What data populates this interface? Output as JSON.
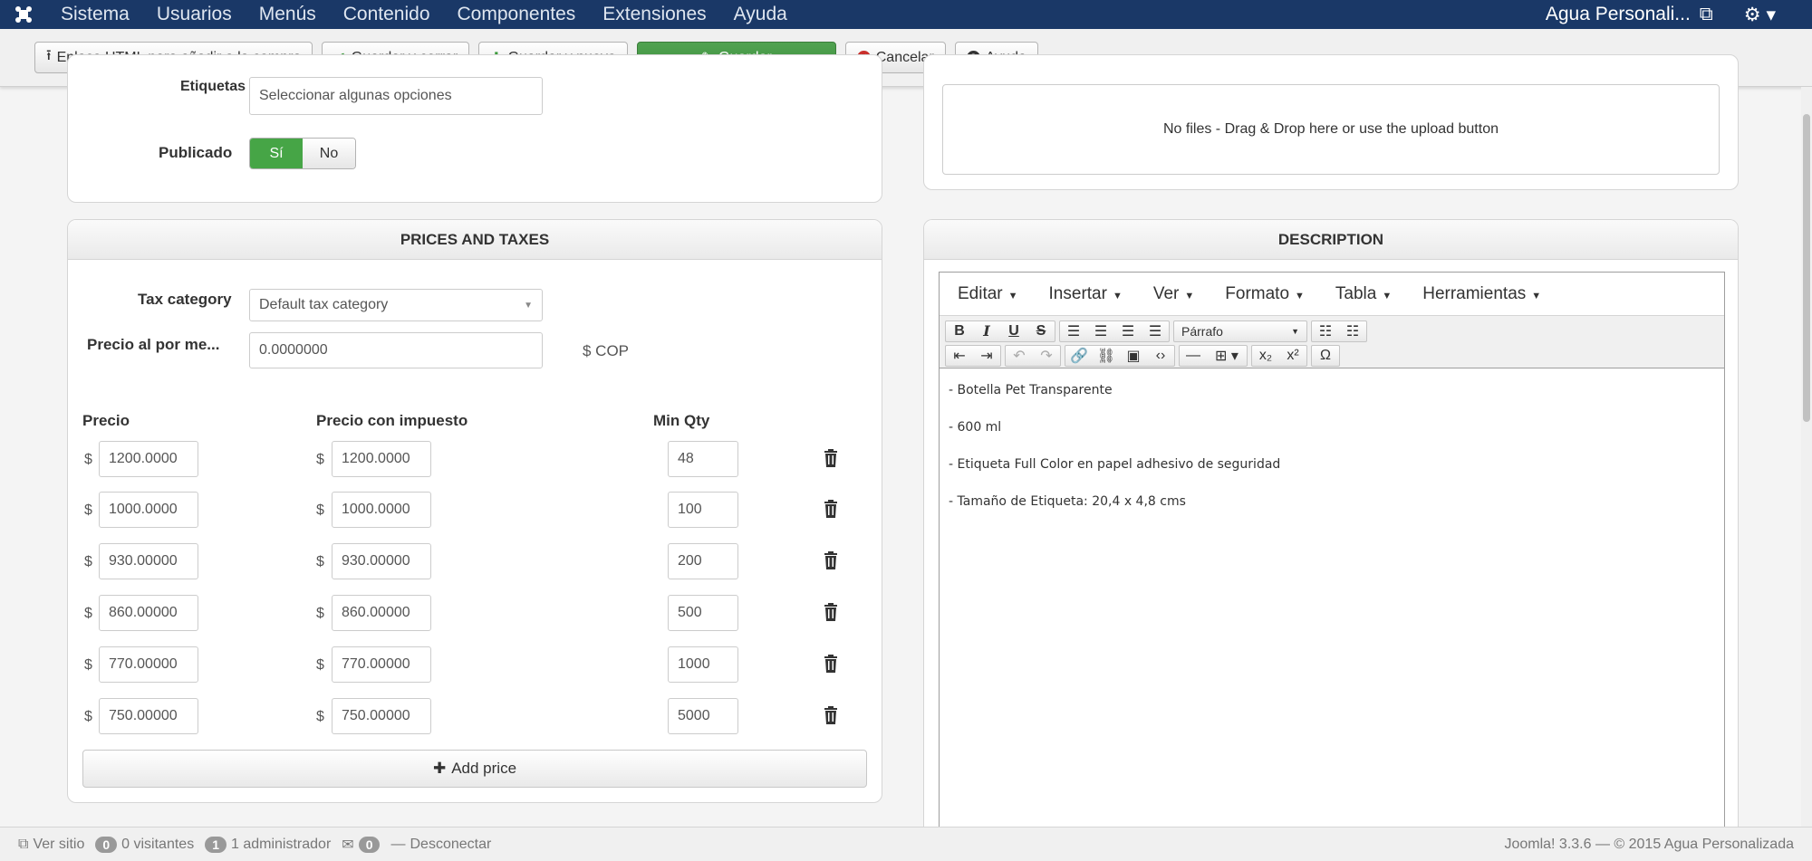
{
  "navbar": {
    "menu": [
      "Sistema",
      "Usuarios",
      "Menús",
      "Contenido",
      "Componentes",
      "Extensiones",
      "Ayuda"
    ],
    "user_label": "Agua Personali..."
  },
  "toolbar": {
    "link_html": "Enlace HTML para añadir a la compra",
    "save_close": "Guardar y cerrar",
    "save_new": "Guardar y nuevo",
    "save": "Guardar",
    "cancel": "Cancelar",
    "help": "Ayuda"
  },
  "details": {
    "tags_label": "Etiquetas",
    "tags_placeholder": "Seleccionar algunas opciones",
    "published_label": "Publicado",
    "yes": "Sí",
    "no": "No"
  },
  "upload": {
    "message": "No files - Drag & Drop here or use the upload button"
  },
  "prices": {
    "title": "PRICES AND TAXES",
    "tax_category_label": "Tax category",
    "tax_category_value": "Default tax category",
    "retail_price_label": "Precio al por me...",
    "retail_price_value": "0.0000000",
    "currency": "$ COP",
    "col_price": "Precio",
    "col_price_tax": "Precio con impuesto",
    "col_min_qty": "Min Qty",
    "dollar": "$",
    "rows": [
      {
        "price": "1200.0000",
        "price_tax": "1200.0000",
        "min_qty": "48"
      },
      {
        "price": "1000.0000",
        "price_tax": "1000.0000",
        "min_qty": "100"
      },
      {
        "price": "930.00000",
        "price_tax": "930.00000",
        "min_qty": "200"
      },
      {
        "price": "860.00000",
        "price_tax": "860.00000",
        "min_qty": "500"
      },
      {
        "price": "770.00000",
        "price_tax": "770.00000",
        "min_qty": "1000"
      },
      {
        "price": "750.00000",
        "price_tax": "750.00000",
        "min_qty": "5000"
      }
    ],
    "add_price": "Add price"
  },
  "description": {
    "title": "DESCRIPTION",
    "menu": [
      "Editar",
      "Insertar",
      "Ver",
      "Formato",
      "Tabla",
      "Herramientas"
    ],
    "format_select": "Párrafo",
    "lines": [
      "- Botella Pet Transparente",
      "- 600 ml",
      "- Etiqueta Full Color en papel adhesivo de seguridad",
      "- Tamaño de Etiqueta: 20,4 x 4,8 cms"
    ]
  },
  "footer": {
    "view_site": "Ver sitio",
    "visitors_count": "0",
    "visitors_label": "0 visitantes",
    "admins_count": "1",
    "admins_label": "1 administrador",
    "messages_count": "0",
    "logout": "Desconectar",
    "copyright": "Joomla! 3.3.6 — © 2015 Agua Personalizada"
  },
  "colors": {
    "navbar": "#1a3867",
    "save_green": "#46a546",
    "cancel_red": "#c9302c"
  }
}
